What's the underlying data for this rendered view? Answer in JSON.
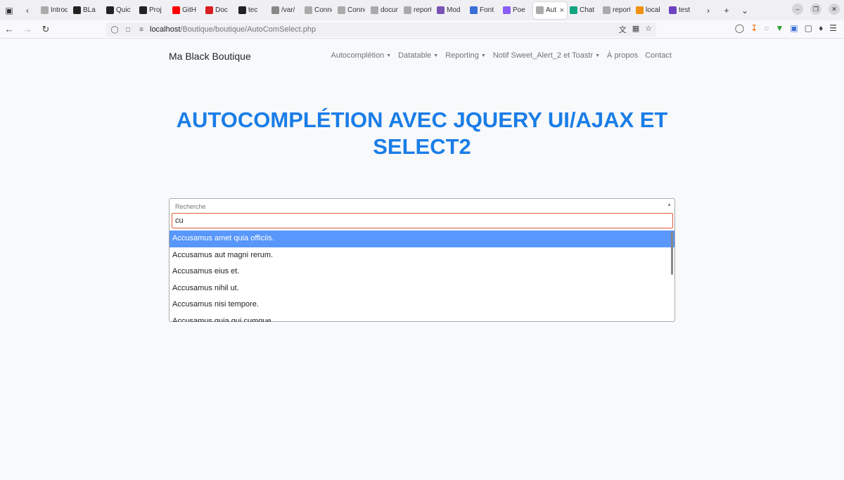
{
  "browser": {
    "tabs": [
      {
        "label": "Introdu",
        "icon": "page-icon",
        "color": "#aaaaaa"
      },
      {
        "label": "BLa",
        "icon": "github-icon",
        "color": "#222222"
      },
      {
        "label": "Quic",
        "icon": "github-icon",
        "color": "#222222"
      },
      {
        "label": "Proj",
        "icon": "github-icon",
        "color": "#222222"
      },
      {
        "label": "GitH",
        "icon": "youtube-icon",
        "color": "#ff0000"
      },
      {
        "label": "Doc",
        "icon": "pdf-icon",
        "color": "#d81e1e"
      },
      {
        "label": "tec",
        "icon": "github-icon",
        "color": "#222222"
      },
      {
        "label": "/var/",
        "icon": "info-icon",
        "color": "#888888"
      },
      {
        "label": "Connex",
        "icon": "page-icon",
        "color": "#aaaaaa"
      },
      {
        "label": "Connex",
        "icon": "page-icon",
        "color": "#aaaaaa"
      },
      {
        "label": "docume",
        "icon": "page-icon",
        "color": "#aaaaaa"
      },
      {
        "label": "reportin",
        "icon": "page-icon",
        "color": "#aaaaaa"
      },
      {
        "label": "Mod",
        "icon": "bootstrap-icon",
        "color": "#7952b3"
      },
      {
        "label": "Font",
        "icon": "flag-icon",
        "color": "#3b6fd8"
      },
      {
        "label": "Poe",
        "icon": "poe-icon",
        "color": "#8b5cf6"
      },
      {
        "label": "Autoc",
        "icon": "page-icon",
        "color": "#aaaaaa",
        "active": true
      },
      {
        "label": "Chat",
        "icon": "chatgpt-icon",
        "color": "#10a37f"
      },
      {
        "label": "reportin",
        "icon": "page-icon",
        "color": "#aaaaaa"
      },
      {
        "label": "local",
        "icon": "phpmyadmin-icon",
        "color": "#f29111"
      },
      {
        "label": "test",
        "icon": "e-icon",
        "color": "#6f42c1"
      }
    ],
    "url_host": "localhost",
    "url_path": "/Boutique/boutique/AutoComSelect.php"
  },
  "page": {
    "brand": "Ma Black Boutique",
    "menu": [
      {
        "label": "Autocomplétion",
        "dropdown": true
      },
      {
        "label": "Datatable",
        "dropdown": true
      },
      {
        "label": "Reporting",
        "dropdown": true
      },
      {
        "label": "Notif Sweet_Alert_2 et Toastr",
        "dropdown": true
      },
      {
        "label": "À propos",
        "dropdown": false
      },
      {
        "label": "Contact",
        "dropdown": false
      }
    ],
    "title": "AUTOCOMPLÉTION AVEC JQUERY UI/AJAX ET SELECT2",
    "select": {
      "placeholder": "Recherche",
      "search_value": "cu",
      "options": [
        "Accusamus amet quia officiis.",
        "Accusamus aut magni rerum.",
        "Accusamus eius et.",
        "Accusamus nihil ut.",
        "Accusamus nisi tempore.",
        "Accusamus quia qui cumque."
      ],
      "highlighted_index": 0,
      "highlight_color": "#5897fb"
    }
  }
}
